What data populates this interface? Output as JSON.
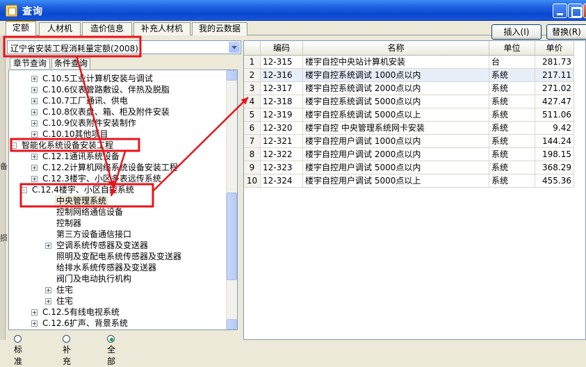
{
  "window": {
    "title": "查询"
  },
  "tabs": [
    "定额",
    "人材机",
    "造价信息",
    "补充人材机",
    "我的云数据"
  ],
  "toolbar": {
    "insert_label": "插入(I)",
    "replace_label": "替换(R)"
  },
  "quota_combo": {
    "value": "辽宁省安装工程消耗量定额(2008)"
  },
  "subtabs": [
    "章节查询",
    "条件查询"
  ],
  "tree_items": [
    {
      "label": "C.10.5工业计算机安装与调试",
      "state": "+"
    },
    {
      "label": "C.10.6仪表管路敷设、伴热及脱脂",
      "state": "+"
    },
    {
      "label": "C.10.7工厂通讯、供电",
      "state": "+"
    },
    {
      "label": "C.10.8仪表盘、箱、柜及附件安装",
      "state": "+"
    },
    {
      "label": "C.10.9仪表附件安装制作",
      "state": "+"
    },
    {
      "label": "C.10.10其他项目",
      "state": "+"
    },
    {
      "label": "智能化系统设备安装工程",
      "state": "-"
    },
    {
      "label": "C.12.1通讯系统设备",
      "state": "+"
    },
    {
      "label": "C.12.2计算机网络系统设备安装工程",
      "state": "+"
    },
    {
      "label": "C.12.3楼宇、小区多表远传系统",
      "state": "+"
    },
    {
      "label": "C.12.4楼宇、小区自控系统",
      "state": "-"
    },
    {
      "label": "中央管理系统",
      "state": "",
      "selected": true
    },
    {
      "label": "控制网络通信设备",
      "state": ""
    },
    {
      "label": "控制器",
      "state": ""
    },
    {
      "label": "第三方设备通信接口",
      "state": ""
    },
    {
      "label": "空调系统传感器及变送器",
      "state": "+"
    },
    {
      "label": "照明及变配电系统传感器及变送器",
      "state": ""
    },
    {
      "label": "给排水系统传感器及变送器",
      "state": ""
    },
    {
      "label": "阀门及电动执行机构",
      "state": ""
    },
    {
      "label": "住宅",
      "state": "+"
    },
    {
      "label": "住宅",
      "state": "+"
    },
    {
      "label": "C.12.5有线电视系统",
      "state": "+"
    },
    {
      "label": "C.12.6扩声、背景系统",
      "state": "+"
    }
  ],
  "radios": [
    {
      "label": "标准",
      "checked": false
    },
    {
      "label": "补充",
      "checked": false
    },
    {
      "label": "全部",
      "checked": true
    }
  ],
  "grid": {
    "columns": [
      "编码",
      "名称",
      "单位",
      "单价"
    ],
    "rows": [
      {
        "no": "1",
        "code": "12-315",
        "name": "楼宇自控中央站计算机安装",
        "unit": "台",
        "price": "281.73"
      },
      {
        "no": "2",
        "code": "12-316",
        "name": "楼宇自控系统调试 1000点以内",
        "unit": "系统",
        "price": "217.11"
      },
      {
        "no": "3",
        "code": "12-317",
        "name": "楼宇自控系统调试 2000点以内",
        "unit": "系统",
        "price": "271.02"
      },
      {
        "no": "4",
        "code": "12-318",
        "name": "楼宇自控系统调试 5000点以内",
        "unit": "系统",
        "price": "427.47"
      },
      {
        "no": "5",
        "code": "12-319",
        "name": "楼宇自控系统调试 5000点以上",
        "unit": "系统",
        "price": "511.06"
      },
      {
        "no": "6",
        "code": "12-320",
        "name": "楼宇自控 中央管理系统网卡安装",
        "unit": "系统",
        "price": "9.42"
      },
      {
        "no": "7",
        "code": "12-321",
        "name": "楼宇自控用户调试 1000点以内",
        "unit": "系统",
        "price": "144.24"
      },
      {
        "no": "8",
        "code": "12-322",
        "name": "楼宇自控用户调试 2000点以内",
        "unit": "系统",
        "price": "198.15"
      },
      {
        "no": "9",
        "code": "12-323",
        "name": "楼宇自控用户调试 5000点以内",
        "unit": "系统",
        "price": "368.29"
      },
      {
        "no": "10",
        "code": "12-324",
        "name": "楼宇自控用户调试 5000点以上",
        "unit": "系统",
        "price": "455.36"
      }
    ]
  },
  "left_edge_chars": [
    "备",
    "损"
  ],
  "colors": {
    "annotation": "#e8141c",
    "titlebar": "#0a47d0",
    "selected_row": "#e8eef8"
  }
}
